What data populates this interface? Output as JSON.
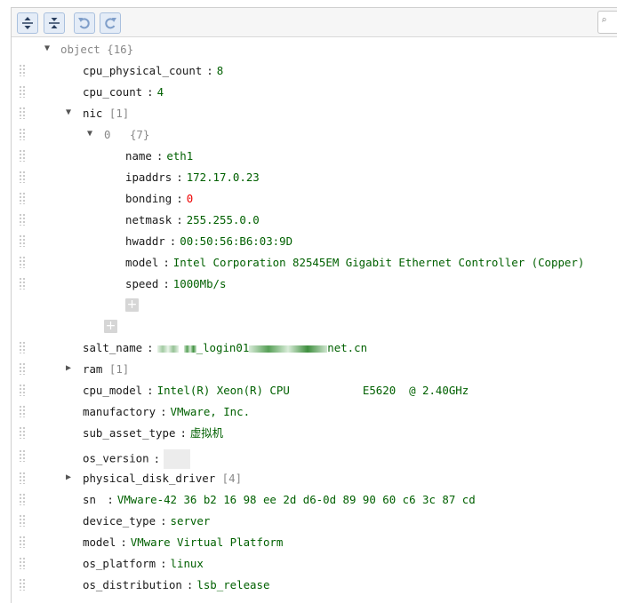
{
  "toolbar": {
    "expand_all_icon": "expand-all-icon",
    "collapse_all_icon": "collapse-all-icon",
    "undo_icon": "undo-icon",
    "redo_icon": "redo-icon"
  },
  "tree": {
    "root": {
      "key": "object",
      "meta": "{16}"
    },
    "cpu_physical_count": {
      "key": "cpu_physical_count",
      "value": "8"
    },
    "cpu_count": {
      "key": "cpu_count",
      "value": "4"
    },
    "nic": {
      "key": "nic",
      "meta": "[1]"
    },
    "nic_0": {
      "key": "0",
      "meta": "{7}"
    },
    "nic_name": {
      "key": "name",
      "value": "eth1"
    },
    "nic_ipaddrs": {
      "key": "ipaddrs",
      "value": "172.17.0.23"
    },
    "nic_bonding": {
      "key": "bonding",
      "value": "0"
    },
    "nic_netmask": {
      "key": "netmask",
      "value": "255.255.0.0"
    },
    "nic_hwaddr": {
      "key": "hwaddr",
      "value": "00:50:56:B6:03:9D"
    },
    "nic_model": {
      "key": "model",
      "value": "Intel Corporation 82545EM Gigabit Ethernet Controller (Copper)"
    },
    "nic_speed": {
      "key": "speed",
      "value": "1000Mb/s"
    },
    "salt_name": {
      "key": "salt_name",
      "value_part1": "_login01",
      "value_part2": "net.cn"
    },
    "ram": {
      "key": "ram",
      "meta": "[1]"
    },
    "cpu_model": {
      "key": "cpu_model",
      "value": "Intel(R) Xeon(R) CPU           E5620  @ 2.40GHz"
    },
    "manufactory": {
      "key": "manufactory",
      "value": "VMware, Inc."
    },
    "sub_asset_type": {
      "key": "sub_asset_type",
      "value": "虚拟机"
    },
    "os_version": {
      "key": "os_version",
      "value": ""
    },
    "physical_disk_driver": {
      "key": "physical_disk_driver",
      "meta": "[4]"
    },
    "sn": {
      "key": "sn ",
      "value": "VMware-42 36 b2 16 98 ee 2d d6-0d 89 90 60 c6 3c 87 cd"
    },
    "device_type": {
      "key": "device_type",
      "value": "server"
    },
    "model": {
      "key": "model",
      "value": "VMware Virtual Platform"
    },
    "os_platform": {
      "key": "os_platform",
      "value": "linux"
    },
    "os_distribution": {
      "key": "os_distribution",
      "value": "lsb_release"
    }
  }
}
